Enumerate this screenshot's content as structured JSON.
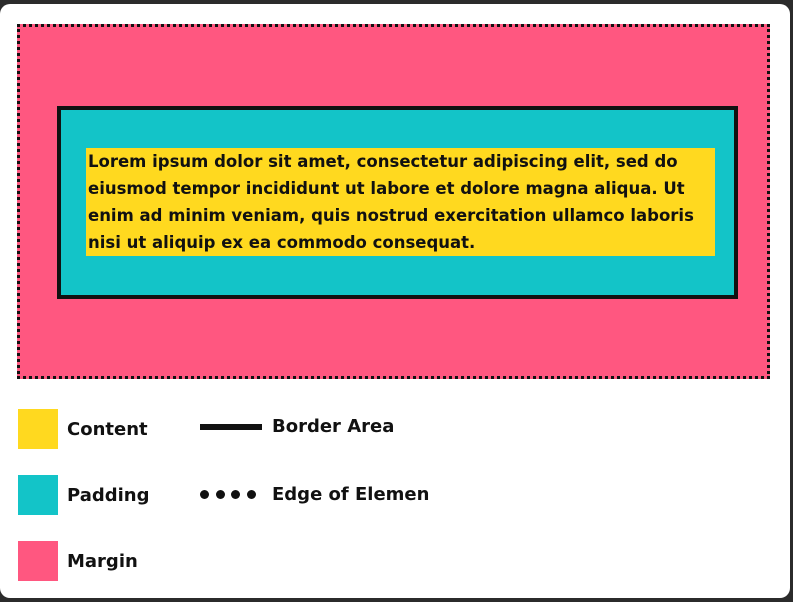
{
  "diagram": {
    "content_text": "Lorem ipsum dolor sit amet, consectetur adipiscing elit, sed do eiusmod tempor incididunt ut labore et dolore magna aliqua. Ut enim ad minim veniam, quis nostrud exercitation ullamco laboris nisi ut aliquip ex ea commodo consequat."
  },
  "legend": {
    "content": "Content",
    "padding": "Padding",
    "margin": "Margin",
    "border_area": "Border Area",
    "edge": "Edge of Elemen"
  },
  "colors": {
    "content": "#ffd91f",
    "padding": "#13c4c8",
    "margin": "#ff5780",
    "border": "#111111"
  }
}
